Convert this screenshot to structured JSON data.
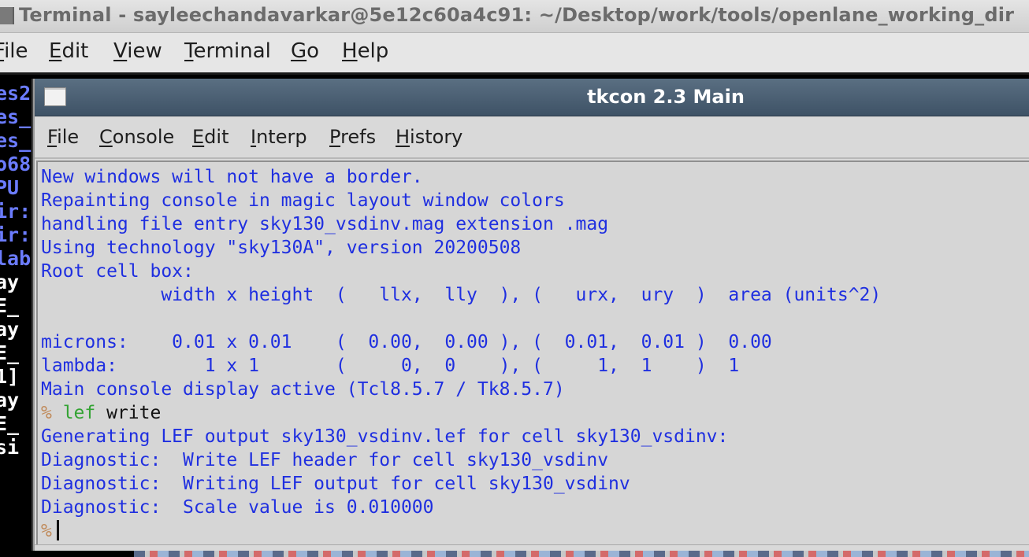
{
  "outer_window": {
    "title": "Terminal - sayleechandavarkar@5e12c60a4c91: ~/Desktop/work/tools/openlane_working_dir",
    "menu": [
      {
        "label": "File",
        "mnemonic": "F"
      },
      {
        "label": "Edit",
        "mnemonic": "E"
      },
      {
        "label": "View",
        "mnemonic": "V"
      },
      {
        "label": "Terminal",
        "mnemonic": "T"
      },
      {
        "label": "Go",
        "mnemonic": "G"
      },
      {
        "label": "Help",
        "mnemonic": "H"
      }
    ],
    "background_lines": [
      {
        "text": "es2",
        "color": "blue"
      },
      {
        "text": "es_",
        "color": "blue"
      },
      {
        "text": "es_",
        "color": "blue"
      },
      {
        "text": "o68",
        "color": "blue"
      },
      {
        "text": "PU",
        "color": "blue"
      },
      {
        "text": "ir:",
        "color": "blue"
      },
      {
        "text": "ir:",
        "color": "blue"
      },
      {
        "text": "lab",
        "color": "blue"
      },
      {
        "text": "ay",
        "color": "white"
      },
      {
        "text": "E_",
        "color": "white"
      },
      {
        "text": "ay",
        "color": "white"
      },
      {
        "text": "E_",
        "color": "white"
      },
      {
        "text": "1]",
        "color": "white"
      },
      {
        "text": "ay",
        "color": "white"
      },
      {
        "text": "E_",
        "color": "white"
      },
      {
        "text": "si",
        "color": "white"
      }
    ]
  },
  "tkcon": {
    "title": "tkcon 2.3 Main",
    "menu": [
      {
        "label": "File",
        "mnemonic": "F"
      },
      {
        "label": "Console",
        "mnemonic": "C"
      },
      {
        "label": "Edit",
        "mnemonic": "E"
      },
      {
        "label": "Interp",
        "mnemonic": "I"
      },
      {
        "label": "Prefs",
        "mnemonic": "P"
      },
      {
        "label": "History",
        "mnemonic": "H"
      }
    ],
    "console_lines": [
      {
        "type": "output",
        "text": "New windows will not have a border."
      },
      {
        "type": "output",
        "text": "Repainting console in magic layout window colors"
      },
      {
        "type": "output",
        "text": "handling file entry sky130_vsdinv.mag extension .mag"
      },
      {
        "type": "output",
        "text": "Using technology \"sky130A\", version 20200508"
      },
      {
        "type": "output",
        "text": "Root cell box:"
      },
      {
        "type": "output",
        "text": "           width x height  (   llx,  lly  ), (   urx,  ury  )  area (units^2)"
      },
      {
        "type": "output",
        "text": ""
      },
      {
        "type": "output",
        "text": "microns:    0.01 x 0.01    (  0.00,  0.00 ), (  0.01,  0.01 )  0.00"
      },
      {
        "type": "output",
        "text": "lambda:        1 x 1       (     0,  0    ), (     1,  1    )  1"
      },
      {
        "type": "output",
        "text": "Main console display active (Tcl8.5.7 / Tk8.5.7)"
      },
      {
        "type": "command",
        "prompt": "%",
        "cmd": "lef",
        "args": "write"
      },
      {
        "type": "output",
        "text": "Generating LEF output sky130_vsdinv.lef for cell sky130_vsdinv:"
      },
      {
        "type": "output",
        "text": "Diagnostic:  Write LEF header for cell sky130_vsdinv"
      },
      {
        "type": "output",
        "text": "Diagnostic:  Writing LEF output for cell sky130_vsdinv"
      },
      {
        "type": "output",
        "text": "Diagnostic:  Scale value is 0.010000"
      },
      {
        "type": "prompt",
        "prompt": "%",
        "input": ""
      }
    ]
  }
}
